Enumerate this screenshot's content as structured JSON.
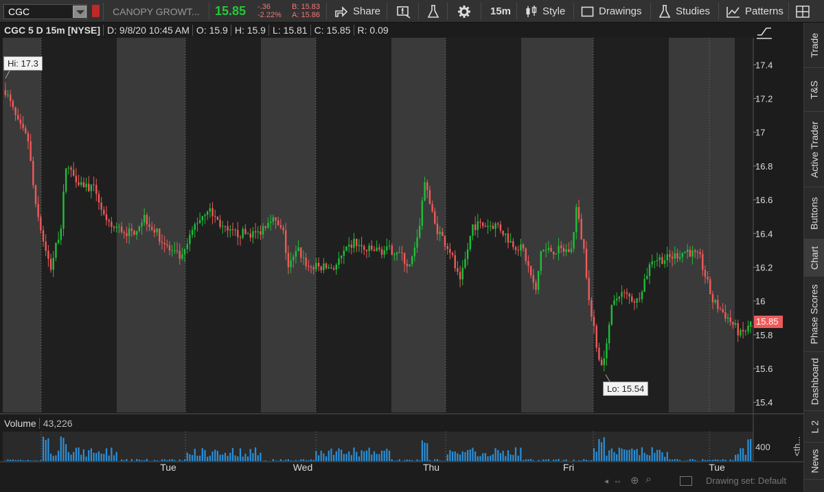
{
  "symbol": "CGC",
  "company": "CANOPY GROWT...",
  "last": "15.85",
  "change": "-.36",
  "change_pct": "-2.22%",
  "bid": "B: 15.83",
  "ask": "A: 15.86",
  "toolbar": {
    "share": "Share",
    "interval": "15m",
    "style": "Style",
    "drawings": "Drawings",
    "studies": "Studies",
    "patterns": "Patterns"
  },
  "chart_header": {
    "title": "CGC 5 D 15m [NYSE]",
    "date": "D: 9/8/20 10:45 AM",
    "open": "O: 15.9",
    "high": "H: 15.9",
    "low": "L: 15.81",
    "close": "C: 15.85",
    "range": "R: 0.09"
  },
  "hi_label": "Hi: 17.3",
  "lo_label": "Lo: 15.54",
  "price_badge": "15.85",
  "volume": {
    "label": "Volume",
    "value": "43,226",
    "axis_label": "400"
  },
  "footer": {
    "drawing_set": "Drawing set: Default"
  },
  "sidebar": [
    "Trade",
    "T&S",
    "Active Trader",
    "Buttons",
    "Chart",
    "Phase Scores",
    "Dashboard",
    "L 2",
    "News"
  ],
  "sidebar_extra": "<th...",
  "colors": {
    "up": "#1fbf3a",
    "down": "#f05a5a",
    "volume": "#2a8fd8",
    "badge": "#f05a5a",
    "last_price": "#26c63a"
  },
  "chart_data": {
    "type": "candlestick",
    "ylim": [
      15.34,
      17.56
    ],
    "y_ticks": [
      17.4,
      17.2,
      17.0,
      16.8,
      16.6,
      16.4,
      16.2,
      16.0,
      15.8,
      15.6,
      15.4
    ],
    "y_tick_labels": [
      "17.4",
      "17.2",
      "17",
      "16.8",
      "16.6",
      "16.4",
      "16.2",
      "16",
      "15.8",
      "15.6",
      "15.4"
    ],
    "x_labels": [
      "Tue",
      "Wed",
      "Thu",
      "Fri",
      "Tue"
    ],
    "session_shading": "alternating regular/extended-hours bands",
    "hi": 17.3,
    "lo": 15.54,
    "waypoints": [
      [
        0,
        17.25
      ],
      [
        5,
        17.05
      ],
      [
        9,
        16.95
      ],
      [
        12,
        16.55
      ],
      [
        16,
        16.3
      ],
      [
        18,
        16.2
      ],
      [
        22,
        16.45
      ],
      [
        24,
        16.8
      ],
      [
        30,
        16.7
      ],
      [
        36,
        16.65
      ],
      [
        40,
        16.45
      ],
      [
        50,
        16.4
      ],
      [
        55,
        16.5
      ],
      [
        60,
        16.4
      ],
      [
        65,
        16.3
      ],
      [
        70,
        16.25
      ],
      [
        75,
        16.45
      ],
      [
        80,
        16.55
      ],
      [
        88,
        16.4
      ],
      [
        95,
        16.4
      ],
      [
        100,
        16.4
      ],
      [
        105,
        16.5
      ],
      [
        110,
        16.4
      ],
      [
        112,
        16.2
      ],
      [
        116,
        16.3
      ],
      [
        120,
        16.2
      ],
      [
        130,
        16.2
      ],
      [
        138,
        16.35
      ],
      [
        142,
        16.3
      ],
      [
        150,
        16.3
      ],
      [
        155,
        16.3
      ],
      [
        160,
        16.2
      ],
      [
        163,
        16.35
      ],
      [
        166,
        16.7
      ],
      [
        170,
        16.45
      ],
      [
        176,
        16.3
      ],
      [
        180,
        16.1
      ],
      [
        185,
        16.45
      ],
      [
        195,
        16.45
      ],
      [
        200,
        16.35
      ],
      [
        205,
        16.3
      ],
      [
        210,
        16.05
      ],
      [
        212,
        16.3
      ],
      [
        218,
        16.3
      ],
      [
        224,
        16.3
      ],
      [
        226,
        16.55
      ],
      [
        229,
        16.3
      ],
      [
        232,
        15.9
      ],
      [
        236,
        15.6
      ],
      [
        240,
        15.95
      ],
      [
        243,
        16.05
      ],
      [
        250,
        16.0
      ],
      [
        256,
        16.25
      ],
      [
        262,
        16.25
      ],
      [
        270,
        16.3
      ],
      [
        275,
        16.25
      ],
      [
        280,
        16.0
      ],
      [
        286,
        15.9
      ],
      [
        291,
        15.8
      ],
      [
        295,
        15.85
      ]
    ],
    "volume_max": 900
  }
}
